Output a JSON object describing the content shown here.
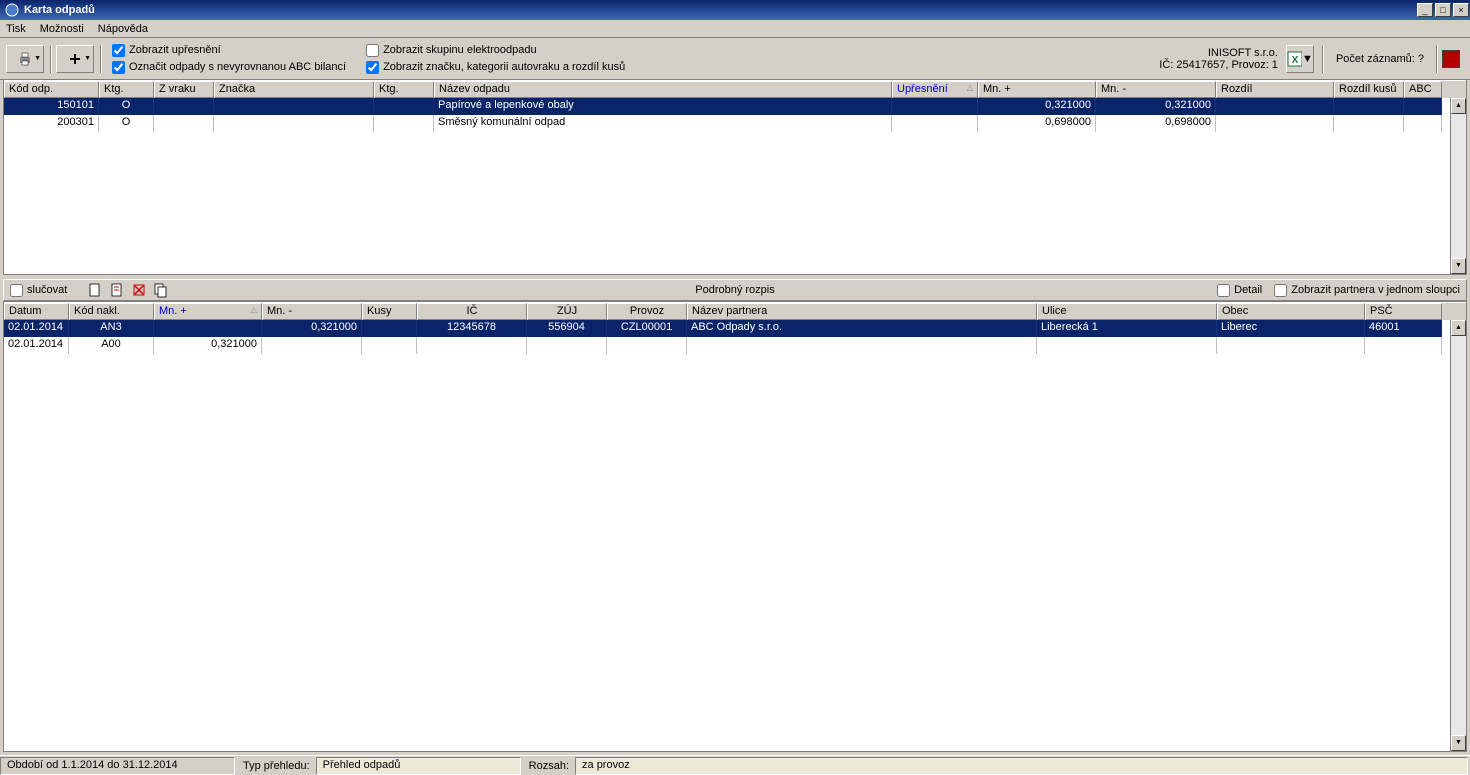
{
  "window": {
    "title": "Karta odpadů"
  },
  "menu": {
    "tisk": "Tisk",
    "moznosti": "Možnosti",
    "napoveda": "Nápověda"
  },
  "toolbar": {
    "chk_upresneni": "Zobrazit upřesnění",
    "chk_abc": "Označit odpady s nevyrovnanou ABC bilancí",
    "chk_elektro": "Zobrazit skupinu elektroodpadu",
    "chk_znacku": "Zobrazit značku, kategorii autovraku a rozdíl kusů",
    "company_name": "INISOFT s.r.o.",
    "company_id": "IČ: 25417657, Provoz: 1",
    "records_label": "Počet záznamů: ?"
  },
  "top_grid": {
    "headers": {
      "kod_odp": "Kód odp.",
      "ktg1": "Ktg.",
      "z_vraku": "Z vraku",
      "znacka": "Značka",
      "ktg2": "Ktg.",
      "nazev": "Název odpadu",
      "upresneni": "Upřesnění",
      "mn_plus": "Mn. +",
      "mn_minus": "Mn. -",
      "rozdil": "Rozdíl",
      "rozdil_kusu": "Rozdíl kusů",
      "abc": "ABC"
    },
    "rows": [
      {
        "kod": "150101",
        "ktg1": "O",
        "zvraku": "",
        "znacka": "",
        "ktg2": "",
        "nazev": "Papírové a lepenkové obaly",
        "upresneni": "",
        "mn_plus": "0,321000",
        "mn_minus": "0,321000",
        "rozdil": "",
        "rozdil_kusu": "",
        "abc": ""
      },
      {
        "kod": "200301",
        "ktg1": "O",
        "zvraku": "",
        "znacka": "",
        "ktg2": "",
        "nazev": "Směsný komunální odpad",
        "upresneni": "",
        "mn_plus": "0,698000",
        "mn_minus": "0,698000",
        "rozdil": "",
        "rozdil_kusu": "",
        "abc": ""
      }
    ]
  },
  "midbar": {
    "slucovat": "slučovat",
    "title": "Podrobný rozpis",
    "detail": "Detail",
    "partner_sloupec": "Zobrazit partnera v jednom sloupci"
  },
  "bot_grid": {
    "headers": {
      "datum": "Datum",
      "kod_nakl": "Kód nakl.",
      "mn_plus": "Mn. +",
      "mn_minus": "Mn. -",
      "kusy": "Kusy",
      "ic": "IČ",
      "zuj": "ZÚJ",
      "provoz": "Provoz",
      "nazev_partnera": "Název partnera",
      "ulice": "Ulice",
      "obec": "Obec",
      "psc": "PSČ"
    },
    "rows": [
      {
        "datum": "02.01.2014",
        "kod": "AN3",
        "mn_plus": "",
        "mn_minus": "0,321000",
        "kusy": "",
        "ic": "12345678",
        "zuj": "556904",
        "provoz": "CZL00001",
        "partner": "ABC Odpady s.r.o.",
        "ulice": "Liberecká 1",
        "obec": "Liberec",
        "psc": "46001"
      },
      {
        "datum": "02.01.2014",
        "kod": "A00",
        "mn_plus": "0,321000",
        "mn_minus": "",
        "kusy": "",
        "ic": "",
        "zuj": "",
        "provoz": "",
        "partner": "",
        "ulice": "",
        "obec": "",
        "psc": ""
      }
    ]
  },
  "statusbar": {
    "obdobi": "Období od 1.1.2014 do 31.12.2014",
    "typ_label": "Typ přehledu:",
    "typ_value": "Přehled odpadů",
    "rozsah_label": "Rozsah:",
    "rozsah_value": "za provoz"
  }
}
